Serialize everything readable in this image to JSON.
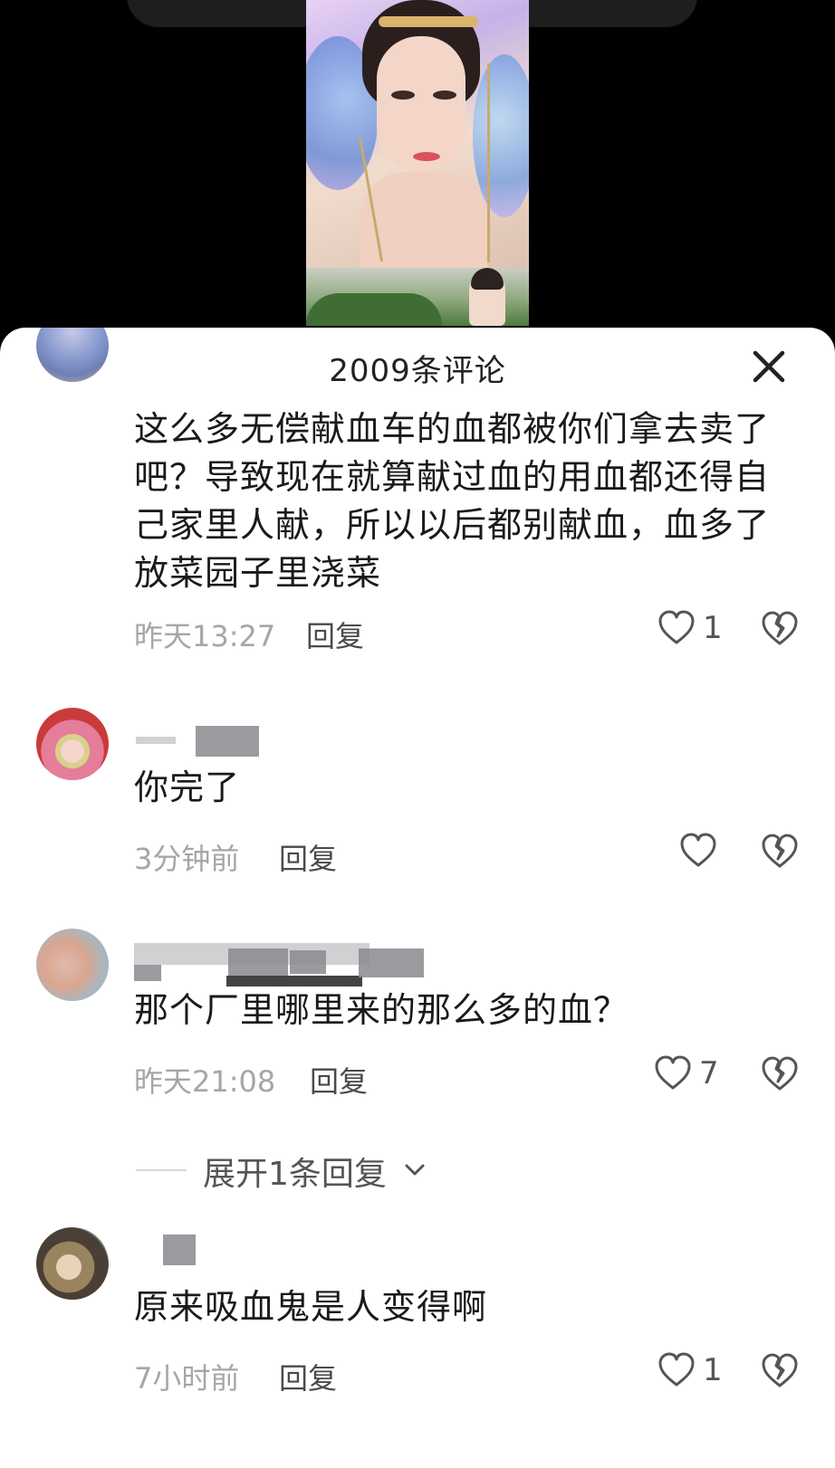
{
  "header": {
    "title": "2009条评论",
    "close_icon": "close-icon"
  },
  "comments": [
    {
      "text": "这么多无偿献血车的血都被你们拿去卖了吧？导致现在就算献过血的用血都还得自己家里人献，所以以后都别献血，血多了放菜园子里浇菜",
      "time": "昨天13:27",
      "reply_label": "回复",
      "likes": "1"
    },
    {
      "text": "你完了",
      "time": "3分钟前",
      "reply_label": "回复",
      "likes": ""
    },
    {
      "text": "那个厂里哪里来的那么多的血？",
      "time": "昨天21:08",
      "reply_label": "回复",
      "likes": "7"
    },
    {
      "text": "原来吸血鬼是人变得啊",
      "time": "7小时前",
      "reply_label": "回复",
      "likes": "1"
    }
  ],
  "expand_replies": "展开1条回复",
  "colors": {
    "panel_bg": "#ffffff",
    "meta_gray": "#a6a6a6",
    "text": "#1a1a1a"
  }
}
